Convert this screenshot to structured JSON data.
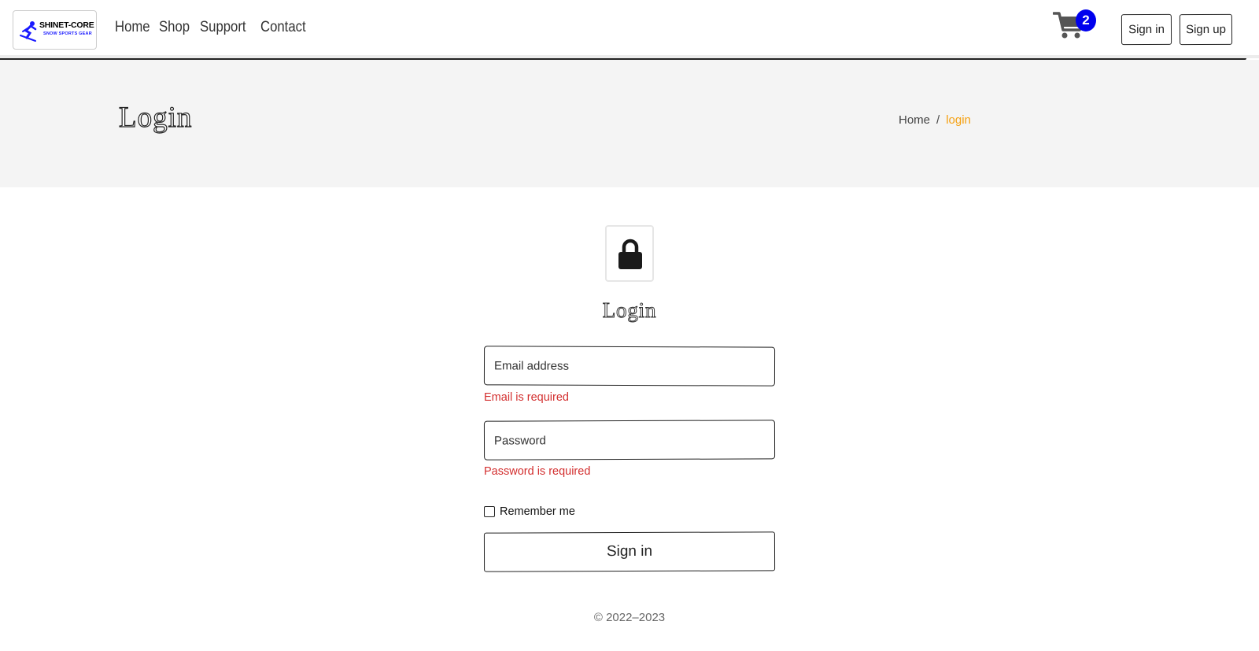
{
  "navbar": {
    "logo": {
      "brand": "SHINET-CORE",
      "tagline": "SNOW SPORTS GEAR",
      "icon": "skier-icon"
    },
    "links": [
      "Home",
      "Shop",
      "Support",
      "Contact"
    ],
    "cart": {
      "icon": "cart-icon",
      "count": "2",
      "badge_color": "#0000ee"
    },
    "sign_in_label": "Sign in",
    "sign_up_label": "Sign up"
  },
  "banner": {
    "title": "Login",
    "breadcrumb": {
      "home": "Home",
      "separator": "/",
      "current": "login",
      "current_color": "#f5a010"
    }
  },
  "login_form": {
    "icon": "lock-icon",
    "title": "Login",
    "email": {
      "placeholder": "Email address",
      "value": "",
      "error": "Email is required"
    },
    "password": {
      "placeholder": "Password",
      "value": "",
      "error": "Password is required"
    },
    "remember_label": "Remember me",
    "remember_checked": false,
    "submit_label": "Sign in",
    "error_color": "#d32f2f"
  },
  "footer": {
    "copyright": "© 2022–2023"
  }
}
